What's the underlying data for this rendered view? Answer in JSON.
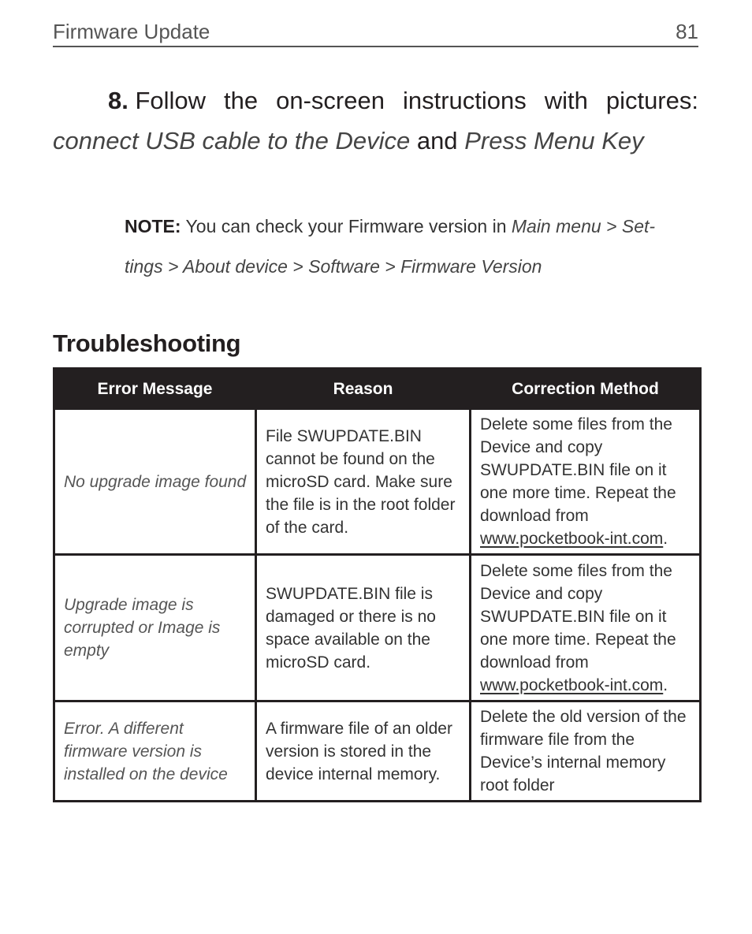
{
  "header": {
    "section_title": "Firmware Update",
    "page_number": "81"
  },
  "step": {
    "number": "8.",
    "words": [
      "Follow",
      "the",
      "on-screen",
      "instructions",
      "with",
      "pictures:"
    ],
    "instruction_1": "connect USB cable to the Device",
    "joiner": "and",
    "instruction_2": "Press Menu Key"
  },
  "note": {
    "label": "NOTE:",
    "text": "You can check your Firmware version in",
    "path_line1": "Main menu > Set-",
    "path_line2": "tings > About device > Software > Firmware Version"
  },
  "troubleshooting": {
    "title": "Troubleshooting",
    "columns": [
      "Error Message",
      "Reason",
      "Correction Method"
    ],
    "rows": [
      {
        "error": "No upgrade image found",
        "reason": "File SWUPDATE.BIN cannot be found on the microSD card. Make sure the file is in the root folder of the card.",
        "correction": "Delete some files from the Device and copy SWUPDATE.BIN file on it one more time. Repeat the download from",
        "link": "www.pocketbook-int.com",
        "suffix": "."
      },
      {
        "error": "Upgrade image is corrupted or Image is empty",
        "reason": "SWUPDATE.BIN file is damaged or there is no space available on the microSD card.",
        "correction": "Delete some files from the Device and copy SWUPDATE.BIN file on it one more time. Repeat the download from",
        "link": "www.pocketbook-int.com",
        "suffix": "."
      },
      {
        "error": "Error. A different firmware version is installed on the device",
        "reason": "A firmware file of an older version is stored in the device internal memory.",
        "correction": "Delete the old version of the firmware file from the Device’s internal memory root folder",
        "link": null,
        "suffix": ""
      }
    ]
  }
}
